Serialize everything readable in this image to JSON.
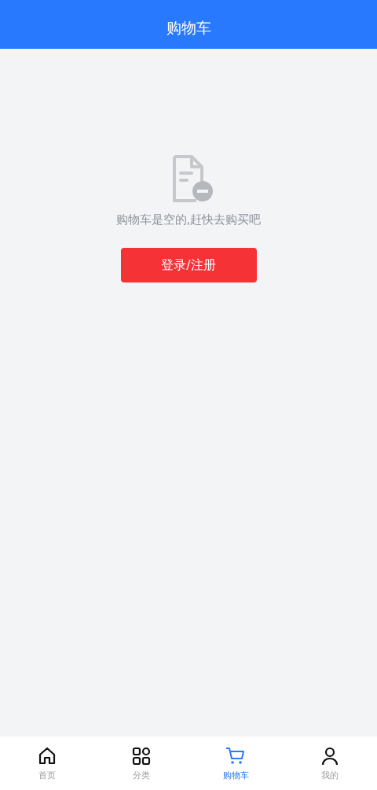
{
  "header": {
    "title": "购物车"
  },
  "empty_state": {
    "message": "购物车是空的,赶快去购买吧",
    "button": "登录/注册"
  },
  "tab_bar": [
    {
      "kind": "home",
      "label": "首页",
      "selected": false
    },
    {
      "kind": "grid",
      "label": "分类",
      "selected": false
    },
    {
      "kind": "cart",
      "label": "购物车",
      "selected": true
    },
    {
      "kind": "user",
      "label": "我的",
      "selected": false
    }
  ]
}
